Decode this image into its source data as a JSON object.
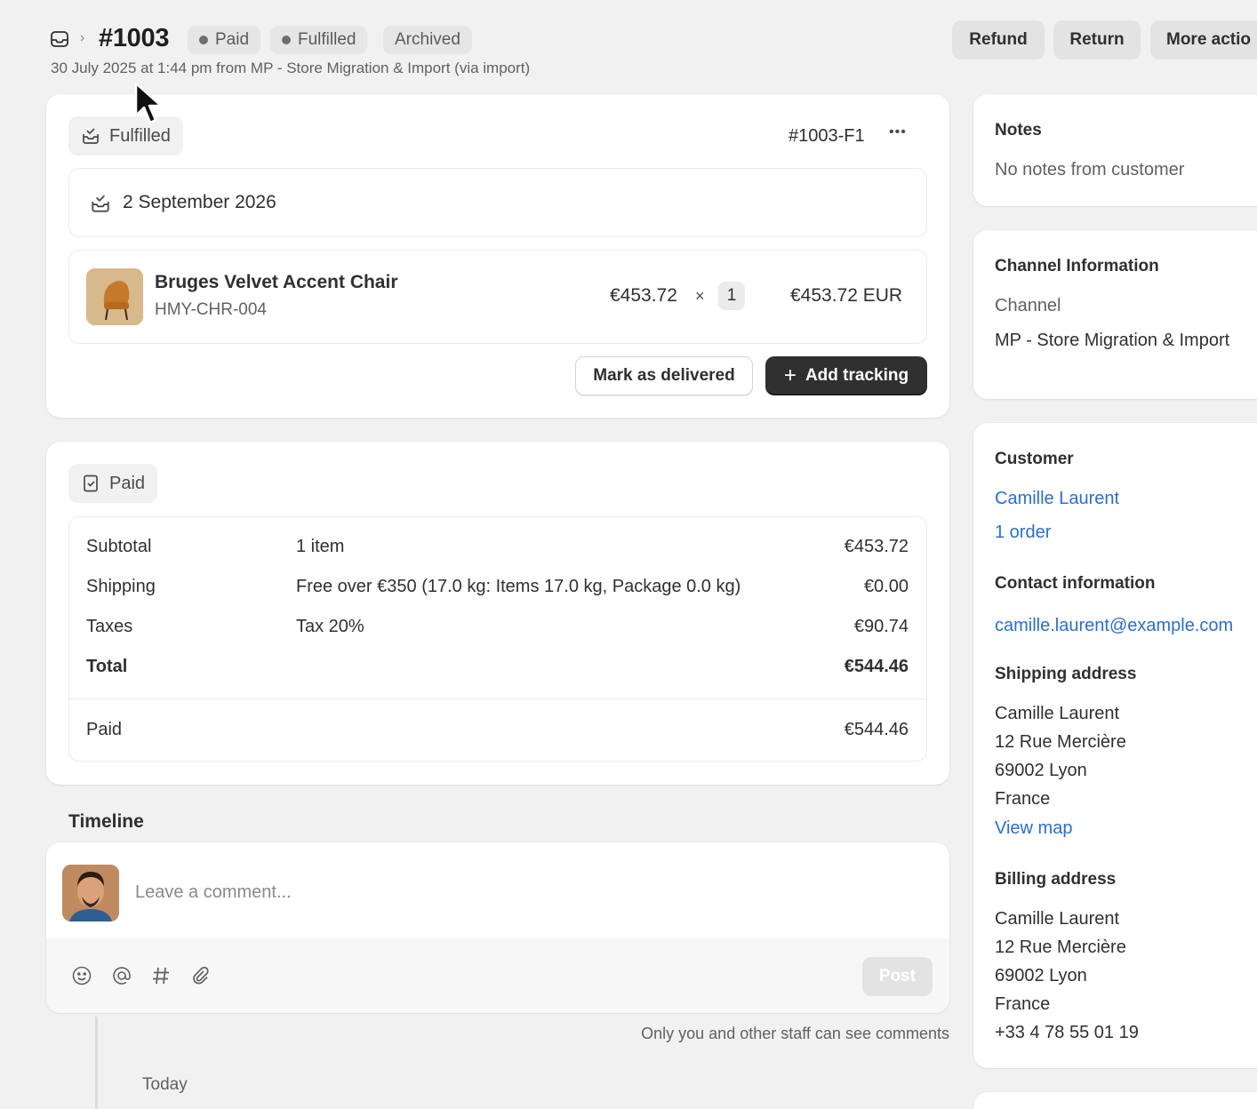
{
  "header": {
    "order_number": "#1003",
    "badges": [
      "Paid",
      "Fulfilled",
      "Archived"
    ],
    "subtitle": "30 July 2025 at 1:44 pm from MP - Store Migration & Import (via import)",
    "actions": [
      "Refund",
      "Return",
      "More actio"
    ]
  },
  "fulfillment": {
    "status": "Fulfilled",
    "id": "#1003-F1",
    "menu_glyph": "•••",
    "date": "2 September 2026",
    "product": {
      "name": "Bruges Velvet Accent Chair",
      "sku": "HMY-CHR-004",
      "unit_price": "€453.72",
      "times": "×",
      "quantity": "1",
      "line_total": "€453.72 EUR"
    },
    "mark_delivered": "Mark as delivered",
    "add_tracking": "Add tracking"
  },
  "payment": {
    "status": "Paid",
    "rows": [
      {
        "label": "Subtotal",
        "detail": "1 item",
        "value": "€453.72"
      },
      {
        "label": "Shipping",
        "detail": "Free over €350 (17.0 kg: Items 17.0 kg, Package 0.0 kg)",
        "value": "€0.00"
      },
      {
        "label": "Taxes",
        "detail": "Tax 20%",
        "value": "€90.74"
      },
      {
        "label": "Total",
        "detail": "",
        "value": "€544.46"
      }
    ],
    "paid_label": "Paid",
    "paid_value": "€544.46"
  },
  "timeline": {
    "title": "Timeline",
    "comment_placeholder": "Leave a comment...",
    "post_label": "Post",
    "staff_note": "Only you and other staff can see comments",
    "today": "Today"
  },
  "notes": {
    "title": "Notes",
    "text": "No notes from customer"
  },
  "channel": {
    "title": "Channel Information",
    "label": "Channel",
    "value": "MP - Store Migration & Import"
  },
  "customer": {
    "title": "Customer",
    "name": "Camille Laurent",
    "orders": "1 order",
    "contact_title": "Contact information",
    "email": "camille.laurent@example.com",
    "shipping_title": "Shipping address",
    "shipping_lines": [
      "Camille Laurent",
      "12 Rue Mercière",
      "69002 Lyon",
      "France"
    ],
    "view_map": "View map",
    "billing_title": "Billing address",
    "billing_lines": [
      "Camille Laurent",
      "12 Rue Mercière",
      "69002 Lyon",
      "France",
      "+33 4 78 55 01 19"
    ]
  },
  "colors": {
    "background": "#f1f1f1",
    "card": "#ffffff",
    "link": "#2c6ecb",
    "primary_button": "#303030"
  }
}
